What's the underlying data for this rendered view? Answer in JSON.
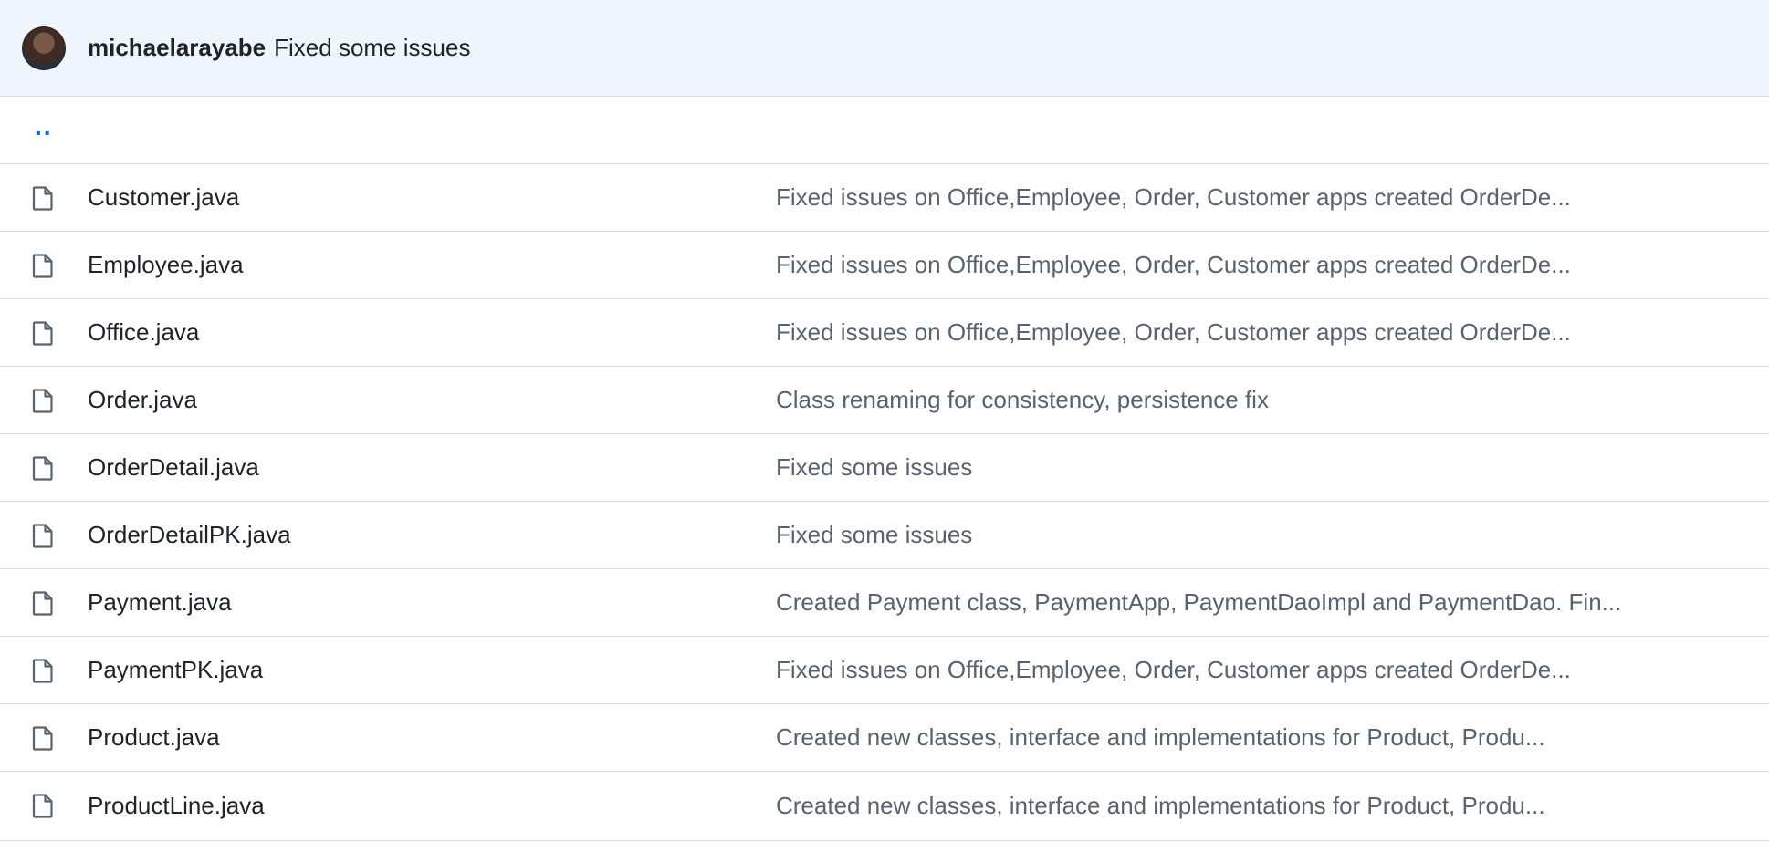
{
  "commit": {
    "author": "michaelarayabe",
    "message": "Fixed some issues"
  },
  "parent_link": "..",
  "files": [
    {
      "name": "Customer.java",
      "commit_message": "Fixed issues on Office,Employee, Order, Customer apps created OrderDe..."
    },
    {
      "name": "Employee.java",
      "commit_message": "Fixed issues on Office,Employee, Order, Customer apps created OrderDe..."
    },
    {
      "name": "Office.java",
      "commit_message": "Fixed issues on Office,Employee, Order, Customer apps created OrderDe..."
    },
    {
      "name": "Order.java",
      "commit_message": "Class renaming for consistency, persistence fix"
    },
    {
      "name": "OrderDetail.java",
      "commit_message": "Fixed some issues"
    },
    {
      "name": "OrderDetailPK.java",
      "commit_message": "Fixed some issues"
    },
    {
      "name": "Payment.java",
      "commit_message": "Created Payment class, PaymentApp, PaymentDaoImpl and PaymentDao. Fin..."
    },
    {
      "name": "PaymentPK.java",
      "commit_message": "Fixed issues on Office,Employee, Order, Customer apps created OrderDe..."
    },
    {
      "name": "Product.java",
      "commit_message": "Created new classes, interface and implementations for Product, Produ..."
    },
    {
      "name": "ProductLine.java",
      "commit_message": "Created new classes, interface and implementations for Product, Produ..."
    }
  ],
  "icons": {
    "file": "file-icon",
    "avatar": "avatar"
  },
  "colors": {
    "header_bg": "#eef5fd",
    "link": "#0969da",
    "text": "#1f2328",
    "muted": "#59636e",
    "border": "#d8dee4"
  }
}
